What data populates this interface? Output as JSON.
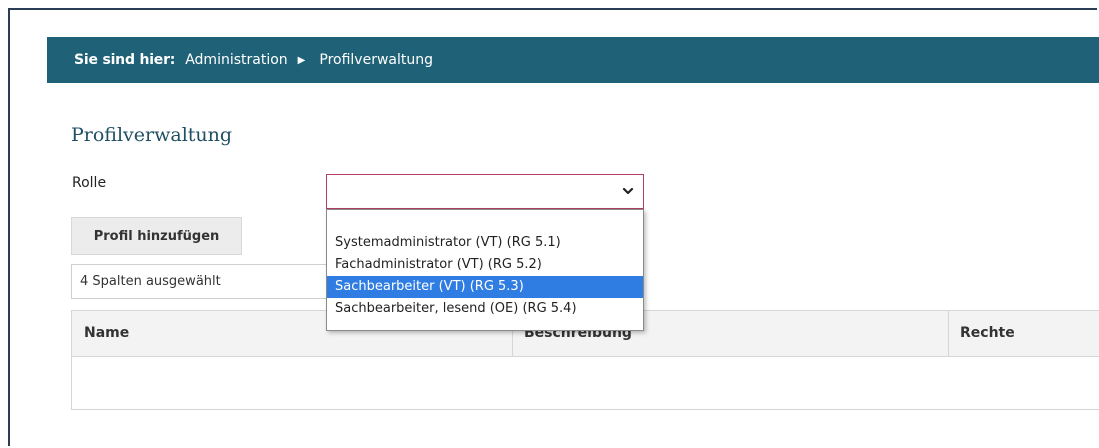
{
  "breadcrumb": {
    "prefix": "Sie sind hier:",
    "items": [
      "Administration",
      "Profilverwaltung"
    ]
  },
  "page": {
    "title": "Profilverwaltung",
    "rolle_label": "Rolle",
    "rolle_value": "",
    "add_profile_button": "Profil hinzufügen",
    "columns_selected": "4 Spalten ausgewählt"
  },
  "dropdown": {
    "options": [
      "",
      "Systemadministrator (VT) (RG 5.1)",
      "Fachadministrator (VT) (RG 5.2)",
      "Sachbearbeiter (VT) (RG 5.3)",
      "Sachbearbeiter, lesend (OE) (RG 5.4)"
    ],
    "highlighted": "Sachbearbeiter (VT) (RG 5.3)",
    "highlight_color": "#2f7de2"
  },
  "table": {
    "headers": [
      "Name",
      "Beschreibung",
      "Rechte"
    ],
    "rows": []
  },
  "colors": {
    "breadcrumb_bar": "#1f6278",
    "title": "#1f4f63",
    "select_border": "#b04060"
  },
  "icons": {
    "breadcrumb_separator": "triangle-right-icon",
    "select_toggle": "chevron-down-icon"
  }
}
